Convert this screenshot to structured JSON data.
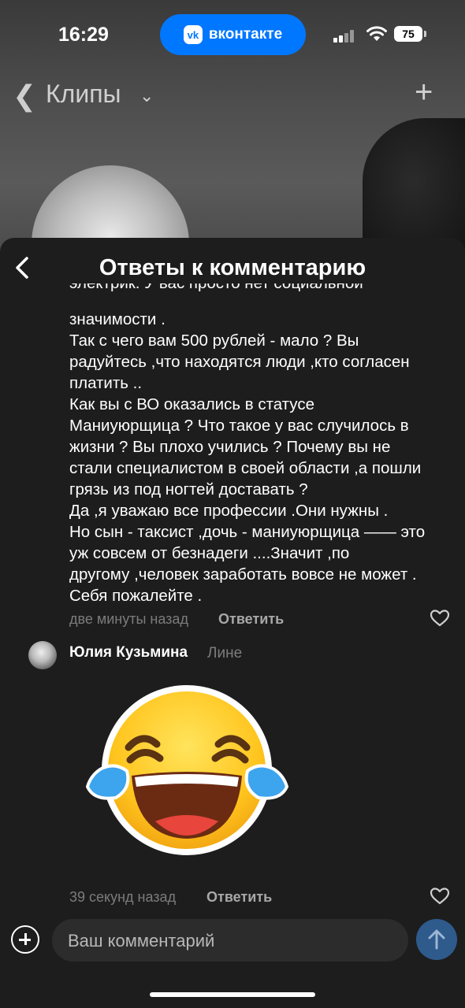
{
  "status_bar": {
    "time": "16:29",
    "app_pill": "вконтакте",
    "vk_logo": "vk",
    "battery": "75"
  },
  "clips_header": {
    "title": "Клипы"
  },
  "sheet": {
    "title": "Ответы к комментарию",
    "comment": {
      "cut_line": "электрик. У вас просто нет социальной",
      "lines": [
        "значимости .",
        "Так с чего вам 500 рублей - мало ? Вы",
        "радуйтесь ,что находятся люди ,кто согласен",
        "платить ..",
        "Как вы с ВО оказались в статусе",
        "Маниуюрщица ? Что такое у вас случилось в",
        "жизни ? Вы плохо учились ? Почему вы не",
        "стали специалистом в своей области ,а пошли",
        "грязь из под ногтей доставать ?",
        "Да ,я уважаю все профессии .Они нужны .",
        "Но сын - таксист ,дочь - маниуюрщица —— это",
        "уж совсем от безнадеги ....Значит ,по",
        "другому ,человек заработать вовсе не может .",
        "Себя пожалейте ."
      ],
      "time": "две минуты назад",
      "reply_label": "Ответить"
    },
    "reply": {
      "author": "Юлия Кузьмина",
      "reply_to": "Лине",
      "sticker": "laughing-tears-emoji",
      "time": "39 секунд назад",
      "reply_label": "Ответить"
    }
  },
  "composer": {
    "placeholder": "Ваш комментарий"
  },
  "colors": {
    "vk_blue": "#0077ff",
    "send_button": "#2e5a8c",
    "sheet_bg": "#1d1d1d"
  }
}
